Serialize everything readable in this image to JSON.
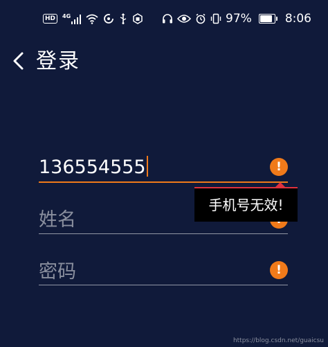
{
  "status_bar": {
    "hd_label": "HD",
    "network_label": "4G",
    "battery_percent": "97%",
    "battery_level": 0.97,
    "time": "8:06",
    "left_icons": [
      "hd-icon",
      "cellular-signal-icon",
      "wifi-icon",
      "data-saver-icon",
      "usb-icon",
      "app-notification-icon"
    ],
    "right_icons": [
      "headset-icon",
      "eye-comfort-icon",
      "alarm-icon",
      "vibrate-icon",
      "battery-icon"
    ]
  },
  "header": {
    "back_icon": "chevron-left-icon",
    "title": "登录"
  },
  "form": {
    "phone": {
      "value": "136554555",
      "error_icon": "error-circle-icon"
    },
    "name": {
      "placeholder": "姓名",
      "error_icon": "error-circle-icon"
    },
    "password": {
      "placeholder": "密码",
      "error_icon": "error-circle-icon"
    },
    "error_glyph": "!"
  },
  "error_tooltip": {
    "message": "手机号无效!"
  },
  "watermark": "https://blog.csdn.net/guaicsu",
  "colors": {
    "background": "#101a3a",
    "accent": "#f07a1a",
    "tooltip_border": "#e0313e",
    "placeholder": "#8a8f9e"
  }
}
